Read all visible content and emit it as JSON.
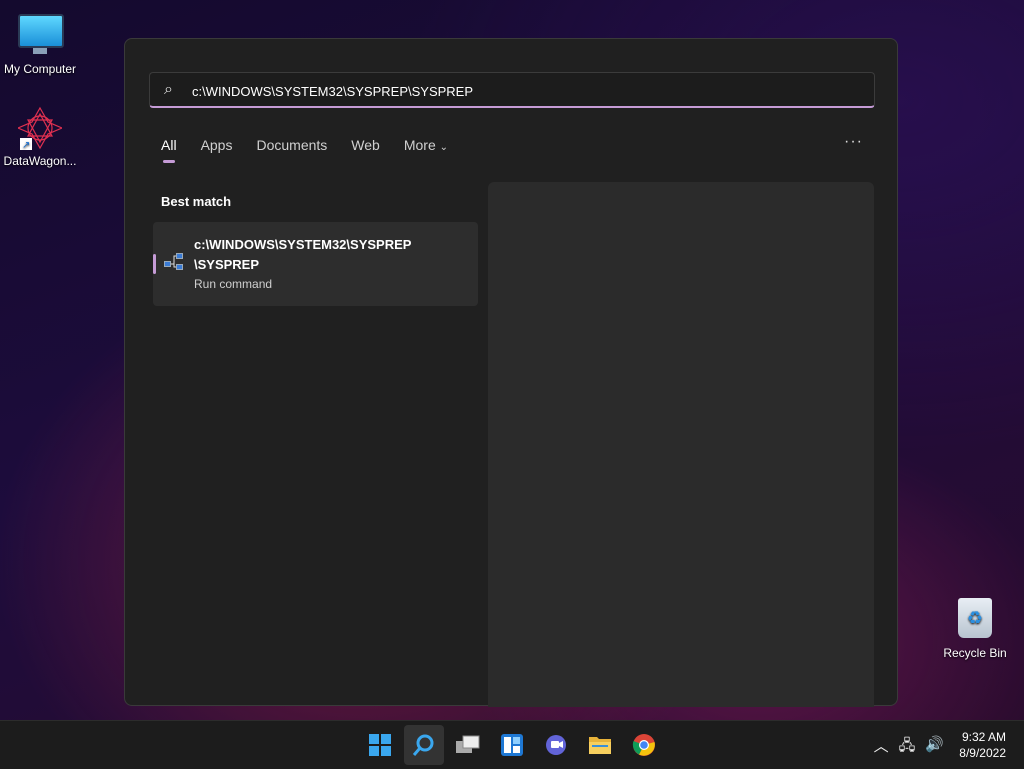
{
  "desktop": {
    "icons": [
      {
        "label": "My Computer",
        "icon": "computer-icon"
      },
      {
        "label": "DataWagon...",
        "icon": "datawagon-icon"
      },
      {
        "label": "Recycle Bin",
        "icon": "recycle-bin-icon"
      }
    ]
  },
  "search": {
    "query": "c:\\WINDOWS\\SYSTEM32\\SYSPREP\\SYSPREP",
    "icon": "search-icon"
  },
  "tabs": [
    {
      "label": "All",
      "active": true
    },
    {
      "label": "Apps"
    },
    {
      "label": "Documents"
    },
    {
      "label": "Web"
    },
    {
      "label": "More"
    }
  ],
  "best_match": {
    "heading": "Best match",
    "title_line1": "c:\\WINDOWS\\SYSTEM32\\SYSPREP",
    "title_line2": "\\SYSPREP",
    "subtitle": "Run command",
    "icon": "network-run-icon"
  },
  "taskbar": {
    "apps": [
      "windows-start-icon",
      "search-icon",
      "task-view-icon",
      "widgets-icon",
      "chat-icon",
      "file-explorer-icon",
      "chrome-icon"
    ],
    "tray": [
      "chevron-up-icon",
      "network-icon",
      "volume-icon"
    ],
    "time": "9:32 AM",
    "date": "8/9/2022"
  },
  "colors": {
    "accent": "#c59bd6",
    "panel": "#202020",
    "taskbar": "#1c1c1c"
  }
}
